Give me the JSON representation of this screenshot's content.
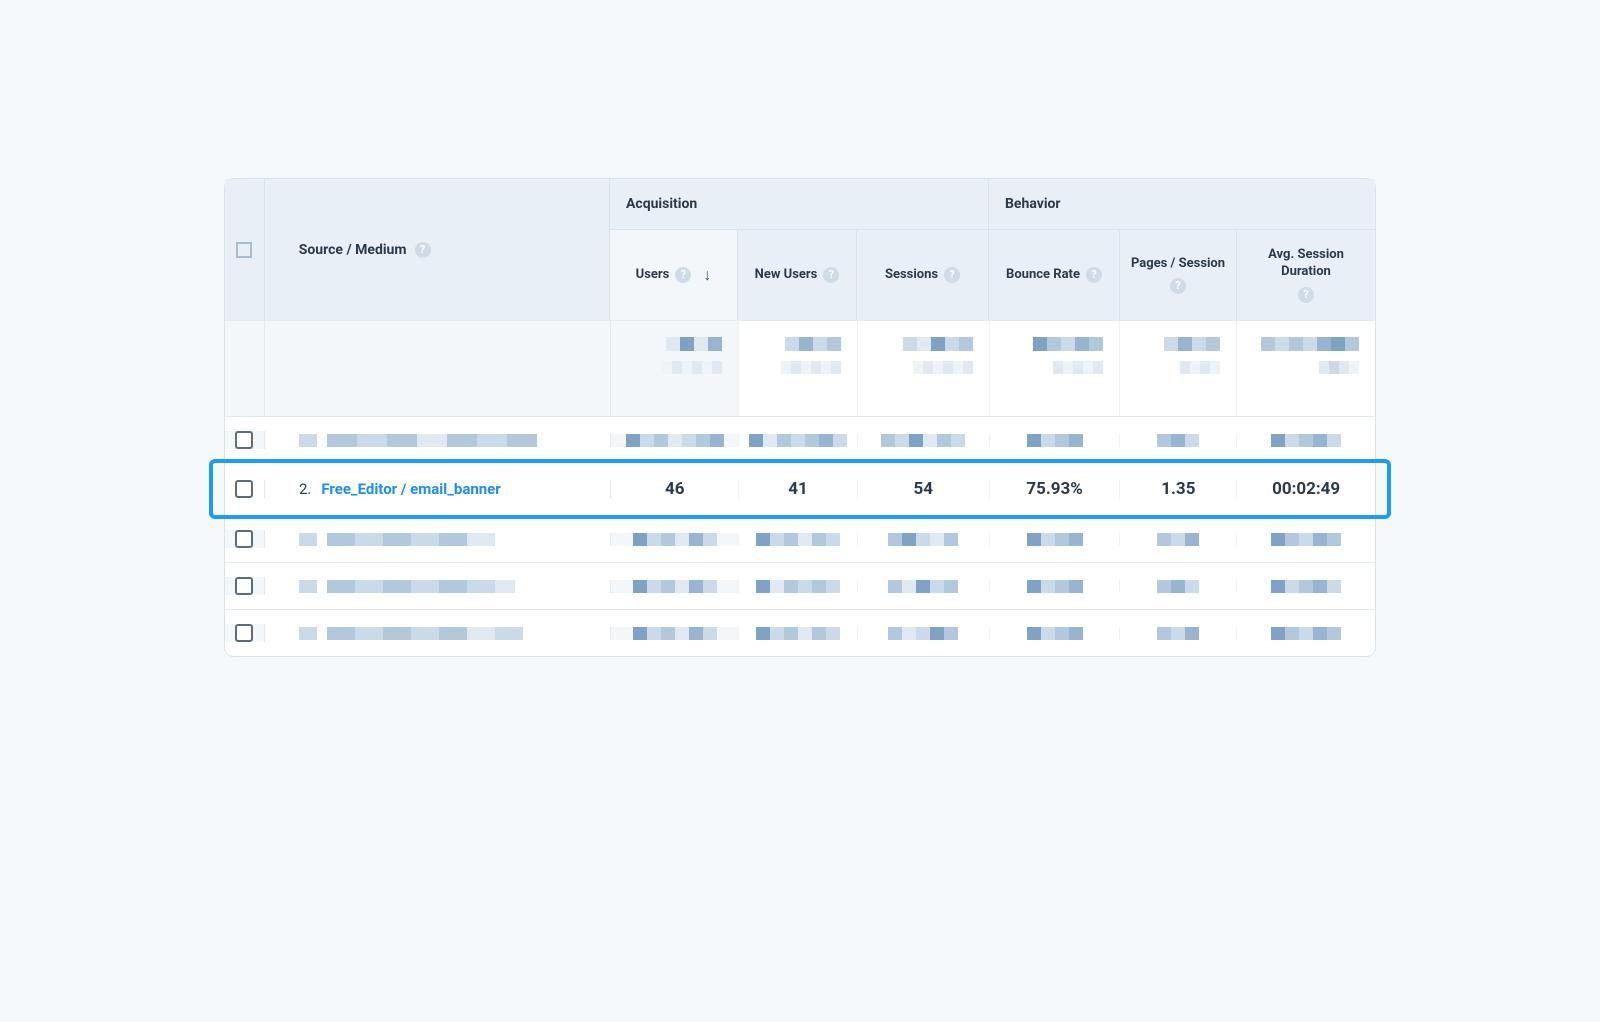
{
  "header": {
    "source_medium_label": "Source / Medium",
    "groups": {
      "acquisition": "Acquisition",
      "behavior": "Behavior"
    },
    "columns": {
      "users": "Users",
      "new_users": "New Users",
      "sessions": "Sessions",
      "bounce_rate": "Bounce Rate",
      "pages_session": "Pages / Session",
      "avg_session_duration": "Avg. Session Duration"
    },
    "sort_column": "users",
    "sort_direction": "desc"
  },
  "highlighted_row": {
    "index": "2.",
    "source_medium": "Free_Editor / email_banner",
    "users": "46",
    "new_users": "41",
    "sessions": "54",
    "bounce_rate": "75.93%",
    "pages_session": "1.35",
    "avg_session_duration": "00:02:49"
  },
  "help_glyph": "?"
}
